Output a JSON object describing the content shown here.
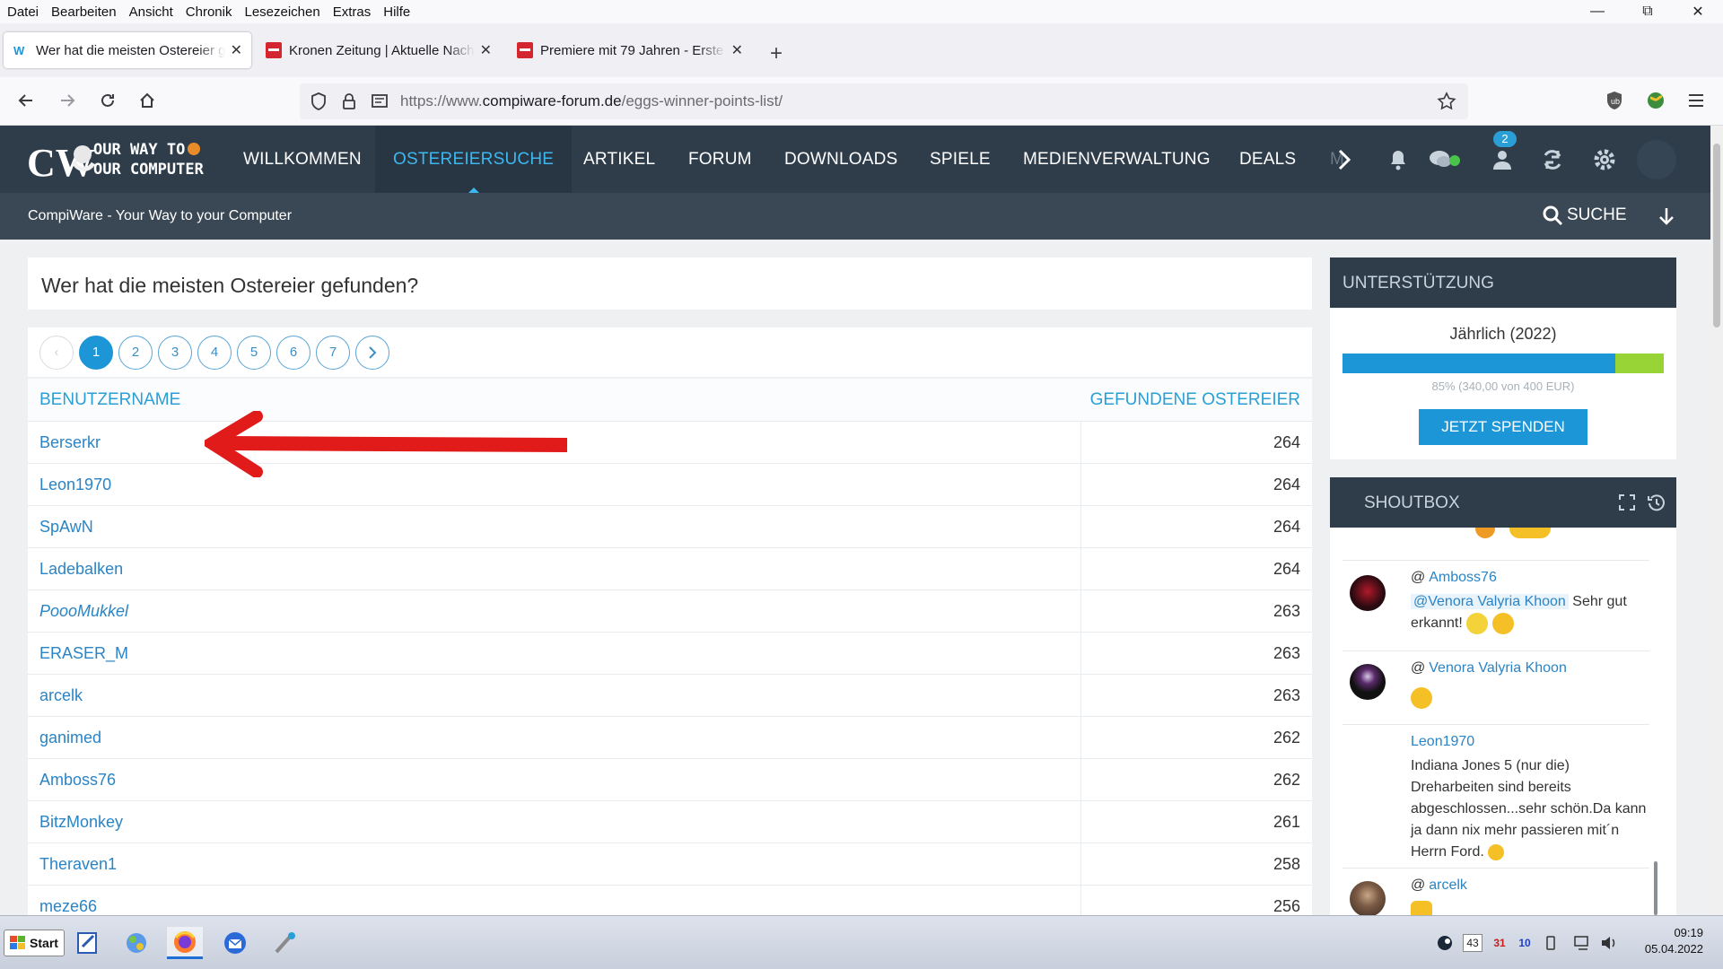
{
  "browser": {
    "menu": [
      "Datei",
      "Bearbeiten",
      "Ansicht",
      "Chronik",
      "Lesezeichen",
      "Extras",
      "Hilfe"
    ],
    "tabs": [
      {
        "title": "Wer hat die meisten Ostereier g",
        "active": true
      },
      {
        "title": "Kronen Zeitung | Aktuelle Nach",
        "active": false
      },
      {
        "title": "Premiere mit 79 Jahren - Erste g",
        "active": false
      }
    ],
    "url_prefix": "https://www.",
    "url_domain": "compiware-forum.de",
    "url_path": "/eggs-winner-points-list/"
  },
  "site": {
    "logo_text": "YOUR WAY TO YOUR COMPUTER",
    "nav": [
      "WILLKOMMEN",
      "OSTEREIERSUCHE",
      "ARTIKEL",
      "FORUM",
      "DOWNLOADS",
      "SPIELE",
      "MEDIENVERWALTUNG",
      "DEALS",
      "M"
    ],
    "active_nav": "OSTEREIERSUCHE",
    "notification_badge": "2",
    "breadcrumb": "CompiWare - Your Way to your Computer",
    "search_label": "SUCHE",
    "accent_color": "#1d96d8",
    "header_color": "#2f3d4b"
  },
  "page": {
    "title": "Wer hat die meisten Ostereier gefunden?",
    "pagination": [
      "1",
      "2",
      "3",
      "4",
      "5",
      "6",
      "7"
    ],
    "current_page": "1",
    "table": {
      "col_user": "BENUTZERNAME",
      "col_count": "GEFUNDENE OSTEREIER",
      "rows": [
        {
          "user": "Berserkr",
          "count": "264"
        },
        {
          "user": "Leon1970",
          "count": "264"
        },
        {
          "user": "SpAwN",
          "count": "264"
        },
        {
          "user": "Ladebalken",
          "count": "264"
        },
        {
          "user": "PoooMukkel",
          "count": "263"
        },
        {
          "user": "ERASER_M",
          "count": "263"
        },
        {
          "user": "arcelk",
          "count": "263"
        },
        {
          "user": "ganimed",
          "count": "262"
        },
        {
          "user": "Amboss76",
          "count": "262"
        },
        {
          "user": "BitzMonkey",
          "count": "261"
        },
        {
          "user": "Theraven1",
          "count": "258"
        },
        {
          "user": "meze66",
          "count": "256"
        }
      ]
    }
  },
  "sidebar": {
    "support": {
      "title": "UNTERSTÜTZUNG",
      "period": "Jährlich (2022)",
      "progress": 0.85,
      "progress_text": "85% (340,00 von 400 EUR)",
      "button": "JETZT SPENDEN"
    },
    "shoutbox": {
      "title": "SHOUTBOX",
      "entries": [
        {
          "user": "Amboss76",
          "mention": "@Venora Valyria Khoon",
          "text": "Sehr gut",
          "text2": "erkannt!"
        },
        {
          "user": "Venora Valyria Khoon"
        },
        {
          "user": "Leon1970",
          "text": "Indiana Jones 5 (nur die) Dreharbeiten sind bereits abgeschlossen...sehr schön.Da kann ja dann nix mehr passieren mit´n Herrn Ford."
        },
        {
          "user": "arcelk"
        }
      ]
    }
  },
  "taskbar": {
    "start": "Start",
    "time": "09:19",
    "date": "05.04.2022",
    "tray": [
      "43",
      "31",
      "10"
    ]
  }
}
